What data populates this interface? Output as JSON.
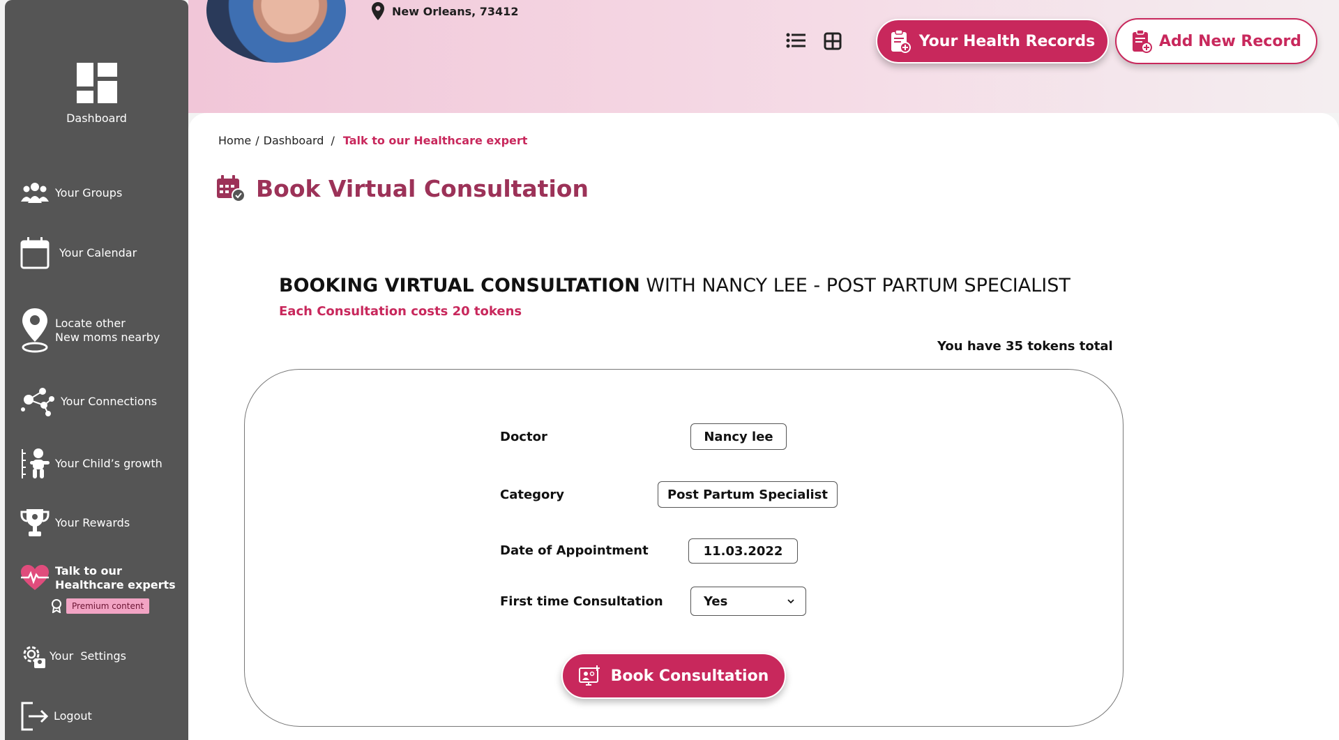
{
  "sidebar": {
    "dashboard_label": "Dashboard",
    "items": [
      {
        "label": "Your Groups",
        "icon": "groups-icon"
      },
      {
        "label": "Your Calendar",
        "icon": "calendar-icon"
      },
      {
        "label_line1": "Locate other",
        "label_line2": "New moms nearby",
        "icon": "location-pin-icon"
      },
      {
        "label": "Your Connections",
        "icon": "connections-icon"
      },
      {
        "label": "Your Child’s growth",
        "icon": "child-growth-icon"
      },
      {
        "label": "Your Rewards",
        "icon": "trophy-icon"
      },
      {
        "label_line1": "Talk to our",
        "label_line2": "Healthcare experts",
        "icon": "heart-pulse-icon",
        "active": true
      },
      {
        "label": "Your  Settings",
        "icon": "settings-icon"
      },
      {
        "label": "Logout",
        "icon": "logout-icon"
      }
    ],
    "premium_badge": "Premium content"
  },
  "header": {
    "location": "New Orleans, 73412",
    "health_records_label": "Your Health Records",
    "add_record_label": "Add New Record"
  },
  "breadcrumb": {
    "home": "Home",
    "sep1": "/",
    "dashboard": "Dashboard",
    "sep2": "/",
    "current": "Talk to our Healthcare expert"
  },
  "page": {
    "title": "Book Virtual Consultation",
    "booking_heading_bold": "BOOKING VIRTUAL CONSULTATION",
    "booking_heading_rest": " WITH NANCY LEE - POST PARTUM SPECIALIST",
    "cost_note": "Each Consultation costs 20 tokens",
    "tokens_total": "You have 35 tokens total"
  },
  "form": {
    "doctor_label": "Doctor",
    "doctor_value": "Nancy lee",
    "category_label": "Category",
    "category_value": "Post Partum Specialist",
    "date_label": "Date of Appointment",
    "date_value": "11.03.2022",
    "first_time_label": "First time Consultation",
    "first_time_value": "Yes",
    "submit_label": "Book Consultation"
  },
  "colors": {
    "accent": "#c8285c",
    "title": "#9c3258",
    "sidebar": "#555555"
  }
}
